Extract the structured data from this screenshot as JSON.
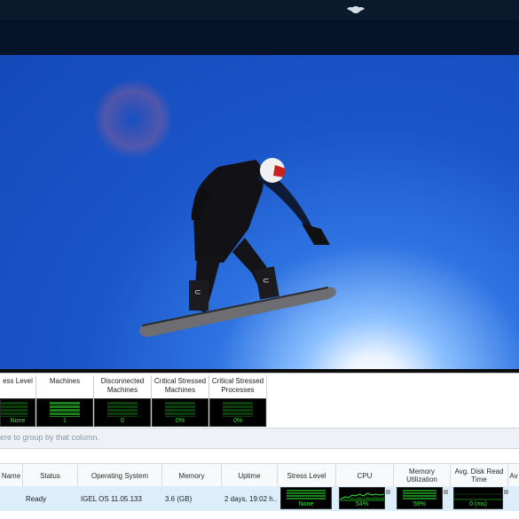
{
  "colors": {
    "accent_green": "#35e835",
    "meter_bg": "#000000",
    "selected_row": "#dceefa",
    "sky": "#1a56c9"
  },
  "header": {
    "logo_icon": "red-bull-logo"
  },
  "tiles": [
    {
      "label": "ess Level",
      "value": "None"
    },
    {
      "label": "Machines",
      "value": "1"
    },
    {
      "label": "Disconnected Machines",
      "value": "0"
    },
    {
      "label": "Critical Stressed Machines",
      "value": "0%"
    },
    {
      "label": "Critical Stressed Processes",
      "value": "0%"
    }
  ],
  "groupbar": {
    "hint": "ere to group by that column."
  },
  "grid": {
    "columns": [
      "Name",
      "Status",
      "Operating System",
      "Memory",
      "Uptime",
      "Stress Level",
      "CPU",
      "Memory Utilization",
      "Avg. Disk Read Time",
      "Av"
    ],
    "row": {
      "name": "",
      "status": "Ready",
      "os": "IGEL OS 11.05.133",
      "memory": "3.6 (GB)",
      "uptime": "2 days, 19:02 h...",
      "stress": "None",
      "cpu": "54%",
      "mem_util": "59%",
      "disk_read": "0 (ms)"
    }
  }
}
